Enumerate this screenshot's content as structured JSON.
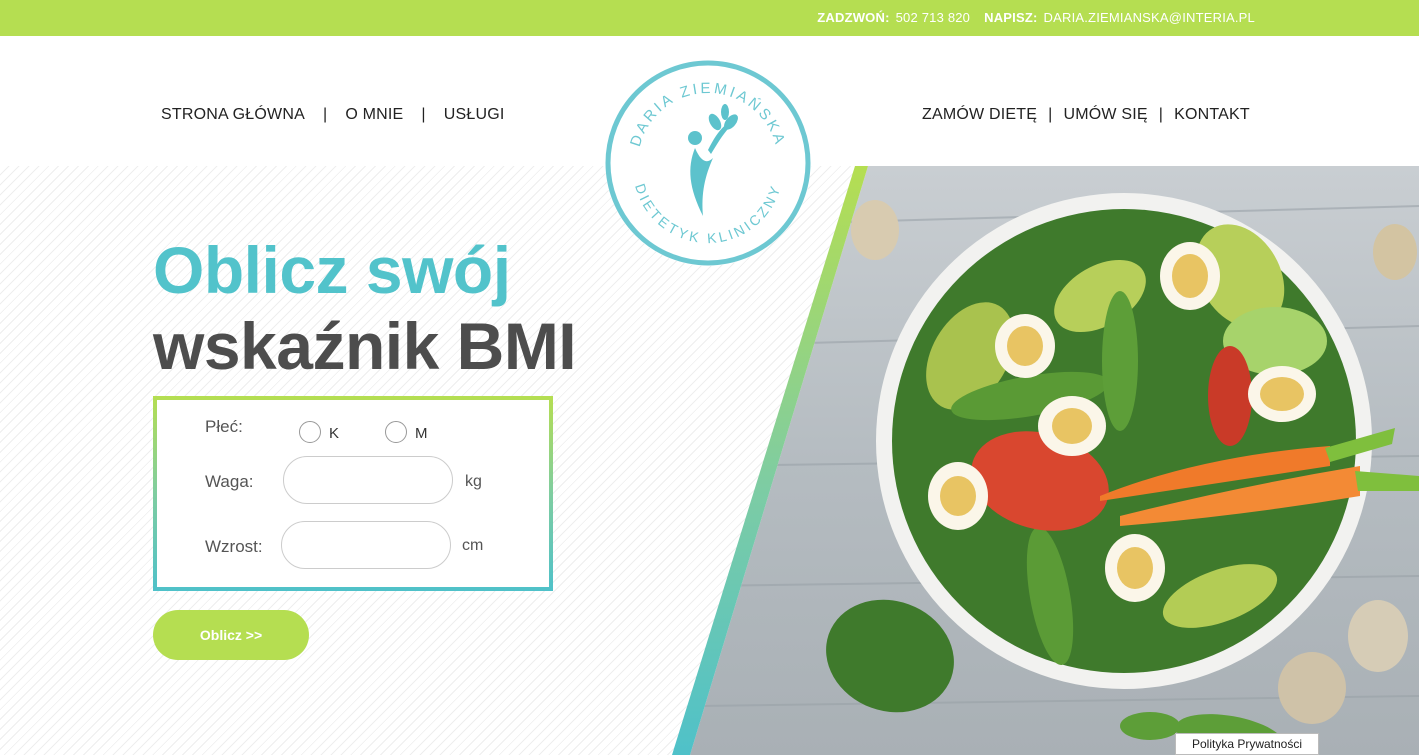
{
  "topbar": {
    "call_label": "ZADZWOŃ:",
    "phone": "502 713 820",
    "write_label": "NAPISZ:",
    "email": "DARIA.ZIEMIANSKA@INTERIA.PL"
  },
  "nav": {
    "left": [
      {
        "label": "STRONA GŁÓWNA"
      },
      {
        "label": "O MNIE"
      },
      {
        "label": "USŁUGI"
      }
    ],
    "right": [
      {
        "label": "ZAMÓW DIETĘ"
      },
      {
        "label": "UMÓW SIĘ"
      },
      {
        "label": "KONTAKT"
      }
    ],
    "separator": "|"
  },
  "logo": {
    "top_text": "DARIA ZIEMIAŃSKA",
    "bottom_text": "DIETETYK KLINICZNY"
  },
  "hero": {
    "title_line1": "Oblicz swój",
    "title_line2": "wskaźnik BMI"
  },
  "form": {
    "sex_label": "Płeć:",
    "option_k": "K",
    "option_m": "M",
    "weight_label": "Waga:",
    "weight_value": "",
    "weight_unit": "kg",
    "height_label": "Wzrost:",
    "height_value": "",
    "height_unit": "cm",
    "submit_label": "Oblicz >>"
  },
  "footer": {
    "privacy_label": "Polityka Prywatności"
  },
  "colors": {
    "accent_green": "#b5de51",
    "accent_teal": "#52c3cb",
    "title_dark": "#4d4d4d"
  }
}
